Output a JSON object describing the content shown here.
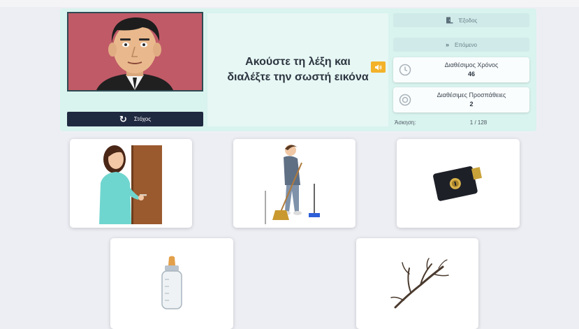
{
  "header": {
    "prompt": "Ακούστε τη λέξη και διαλέξτε την σωστή εικόνα",
    "target_button_label": "Στόχος",
    "exit_label": "Έξοδος",
    "next_label": "Επόμενο"
  },
  "stats": {
    "time_label": "Διαθέσιμος Χρόνος",
    "time_value": "46",
    "attempts_label": "Διαθέσιμες Προσπάθειες",
    "attempts_value": "2"
  },
  "exercise": {
    "label": "Άσκηση:",
    "value": "1 / 128"
  },
  "cards": [
    {
      "icon": "woman-opening-door-icon"
    },
    {
      "icon": "woman-sweeping-broom-icon"
    },
    {
      "icon": "door-lock-icon"
    },
    {
      "icon": "baby-bottle-icon"
    },
    {
      "icon": "tree-branch-icon"
    }
  ],
  "colors": {
    "panel": "#d9f3ee",
    "target_button": "#1f2940",
    "sound_button": "#f3b22a",
    "avatar_bg": "#c05a67"
  }
}
